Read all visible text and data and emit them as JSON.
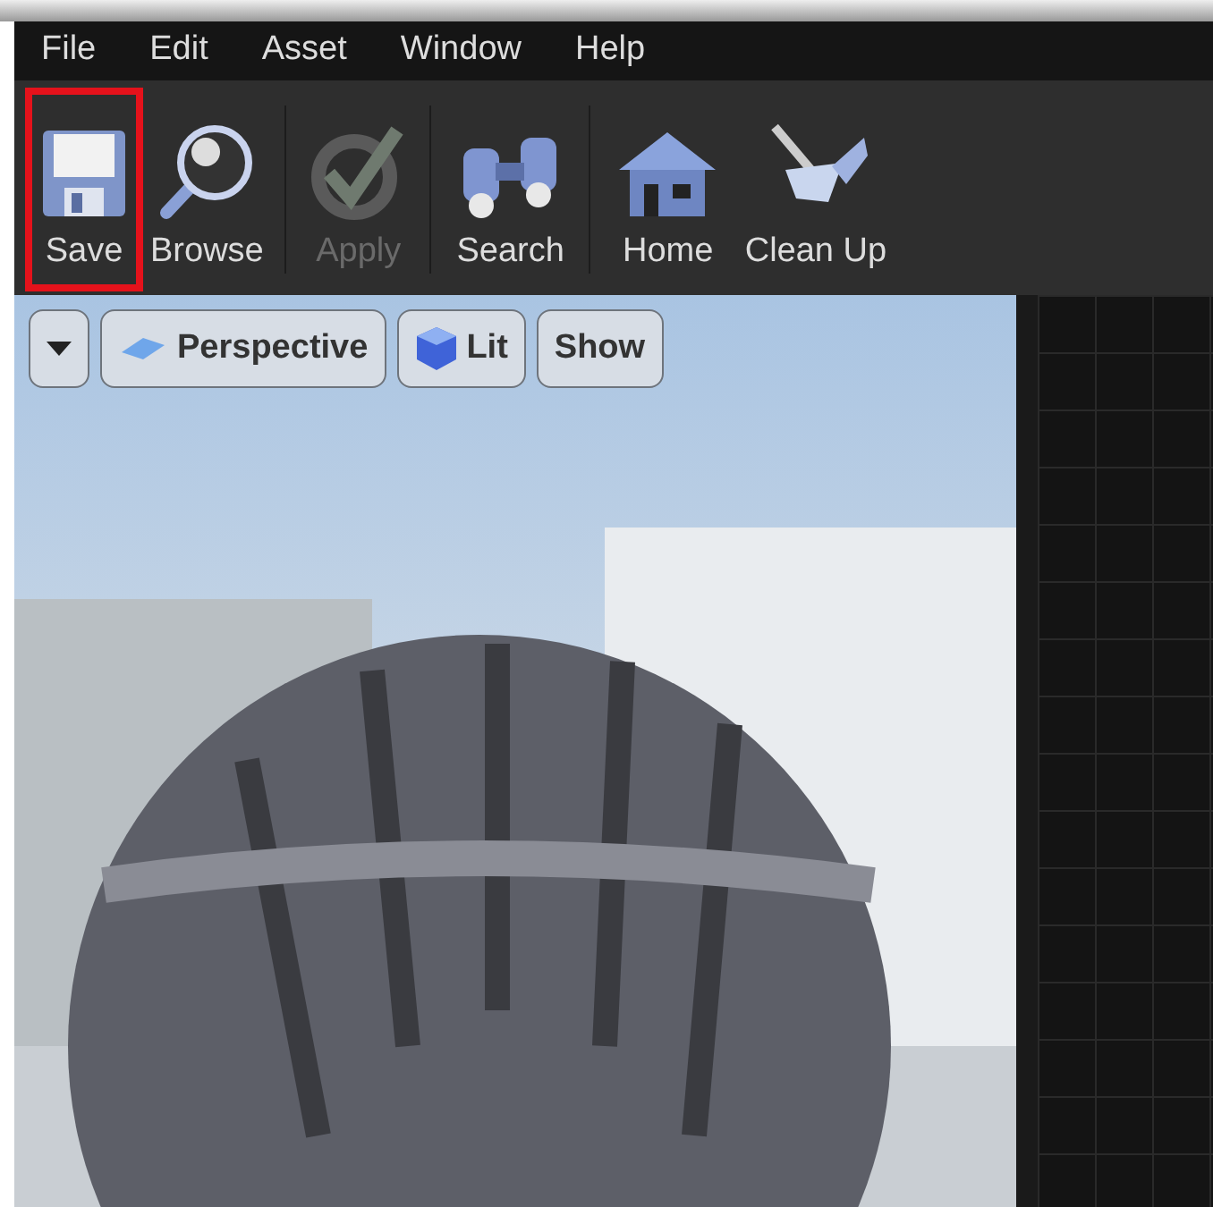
{
  "menu": [
    "File",
    "Edit",
    "Asset",
    "Window",
    "Help"
  ],
  "toolbar": [
    {
      "kind": "save",
      "label": "Save",
      "disabled": false,
      "highlighted": true
    },
    {
      "kind": "browse",
      "label": "Browse",
      "disabled": false,
      "highlighted": false
    },
    {
      "kind": "apply",
      "label": "Apply",
      "disabled": true,
      "highlighted": false
    },
    {
      "kind": "search",
      "label": "Search",
      "disabled": false,
      "highlighted": false
    },
    {
      "kind": "home",
      "label": "Home",
      "disabled": false,
      "highlighted": false
    },
    {
      "kind": "cleanup",
      "label": "Clean Up",
      "disabled": false,
      "highlighted": false
    }
  ],
  "viewport": {
    "buttons": [
      {
        "kind": "menu"
      },
      {
        "kind": "perspective",
        "label": "Perspective"
      },
      {
        "kind": "lit",
        "label": "Lit"
      },
      {
        "kind": "show",
        "label": "Show"
      }
    ]
  }
}
